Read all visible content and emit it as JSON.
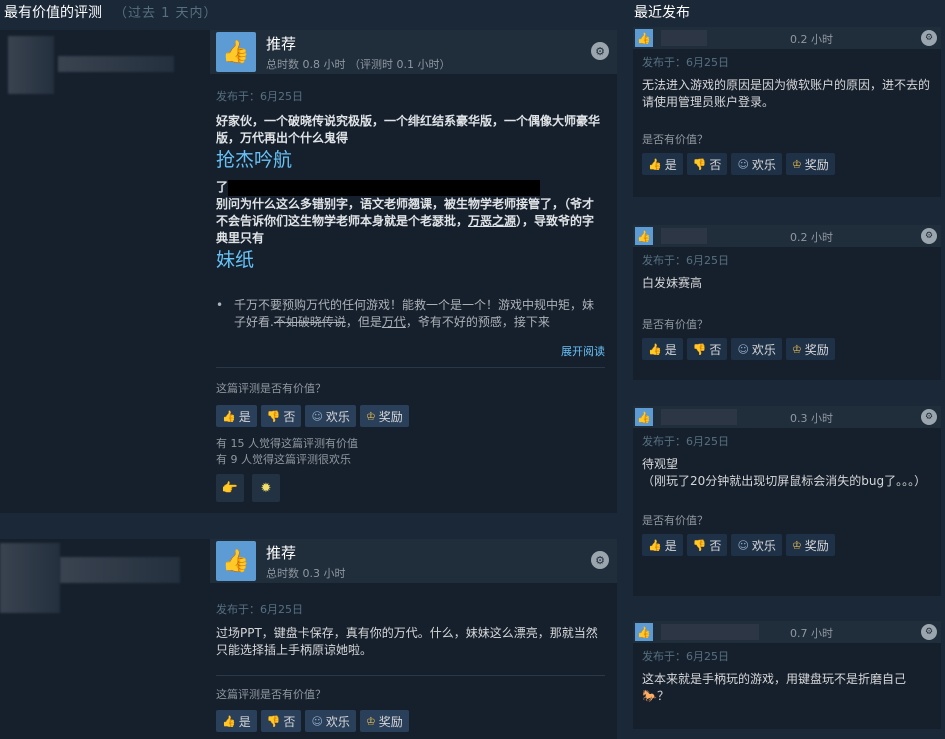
{
  "headers": {
    "left_title": "最有价值的评测",
    "left_sub": "（过去 1 天内）",
    "right_title": "最近发布"
  },
  "reviews": [
    {
      "vote": "推荐",
      "hours": "总时数 0.8 小时 （评测时 0.1 小时）",
      "posted": "发布于：6月25日",
      "line1": "好家伙，一个破晓传说究极版，一个绯红结系豪华版，一个偶像大师豪华版，万代再出个什么鬼得",
      "big1": "抢杰吟航",
      "line2a": "了",
      "line2b": "别问为什么这么多错别字，语文老师翘课，被生物学老师接管了，（爷才不会告诉你们这生物学老师本身就是个老瑟批，",
      "line2c": "万恶之源",
      "line2d": "），导致爷的字典里只有",
      "big2": "妹纸",
      "bullet_a": "千万不要预购万代的任何游戏！能救一个是一个！游戏中规中矩，妹子好看.",
      "bullet_b": "不如破晓传说",
      "bullet_c": "，但是",
      "bullet_d": "万代",
      "bullet_e": "，爷有不好的预感，接下来",
      "readmore": "展开阅读",
      "question": "这篇评测是否有价值？",
      "btn_yes": "是",
      "btn_no": "否",
      "btn_funny": "欢乐",
      "btn_award": "奖励",
      "stat1": "有 15 人觉得这篇评测有价值",
      "stat2": "有 9 人觉得这篇评测很欢乐"
    },
    {
      "vote": "推荐",
      "hours": "总时数 0.3 小时",
      "posted": "发布于：6月25日",
      "text": "过场PPT，键盘卡保存，真有你的万代。什么，妹妹这么漂亮，那就当然只能选择插上手柄原谅她啦。",
      "question": "这篇评测是否有价值？",
      "btn_yes": "是",
      "btn_no": "否",
      "btn_funny": "欢乐",
      "btn_award": "奖励"
    }
  ],
  "recent": [
    {
      "hours": "0.2 小时",
      "posted": "发布于：6月25日",
      "text": "无法进入游戏的原因是因为微软账户的原因，进不去的请使用管理员账户登录。",
      "question": "是否有价值？",
      "btn_yes": "是",
      "btn_no": "否",
      "btn_funny": "欢乐",
      "btn_award": "奖励"
    },
    {
      "hours": "0.2 小时",
      "posted": "发布于：6月25日",
      "text": "白发妹赛高",
      "question": "是否有价值？",
      "btn_yes": "是",
      "btn_no": "否",
      "btn_funny": "欢乐",
      "btn_award": "奖励"
    },
    {
      "hours": "0.3 小时",
      "posted": "发布于：6月25日",
      "text1": "待观望",
      "text2": "（刚玩了20分钟就出现切屏鼠标会消失的bug了。。。）",
      "question": "是否有价值？",
      "btn_yes": "是",
      "btn_no": "否",
      "btn_funny": "欢乐",
      "btn_award": "奖励"
    },
    {
      "hours": "0.7 小时",
      "posted": "发布于：6月25日",
      "text": "这本来就是手柄玩的游戏，用键盘玩不是折磨自己🐎？"
    }
  ],
  "icons": {
    "thumb": "thumbs-up-icon",
    "steam": "steam-icon",
    "funny": "smiley-icon",
    "award": "award-icon"
  }
}
